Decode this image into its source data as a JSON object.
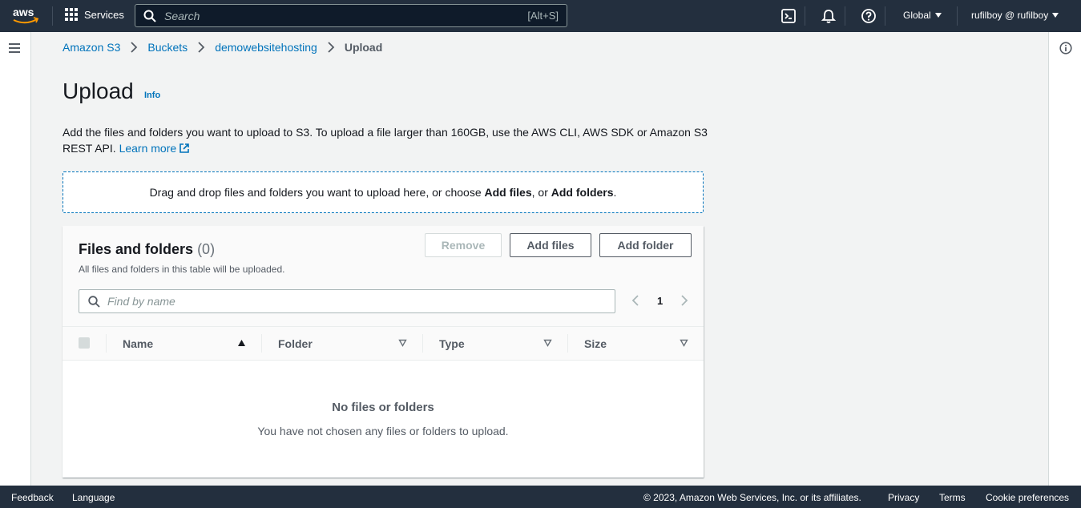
{
  "topnav": {
    "services_label": "Services",
    "search_placeholder": "Search",
    "search_shortcut": "[Alt+S]",
    "region_label": "Global",
    "account_label": "rufilboy @ rufilboy"
  },
  "breadcrumb": {
    "items": [
      "Amazon S3",
      "Buckets",
      "demowebsitehosting"
    ],
    "current": "Upload"
  },
  "page": {
    "title": "Upload",
    "info_label": "Info",
    "description": "Add the files and folders you want to upload to S3. To upload a file larger than 160GB, use the AWS CLI, AWS SDK or Amazon S3 REST API.",
    "learn_more": "Learn more"
  },
  "dropzone": {
    "text_before": "Drag and drop files and folders you want to upload here, or choose ",
    "add_files": "Add files",
    "text_middle": ", or ",
    "add_folders": "Add folders",
    "text_after": "."
  },
  "files_panel": {
    "title": "Files and folders",
    "count": "(0)",
    "subtitle": "All files and folders in this table will be uploaded.",
    "remove_label": "Remove",
    "add_files_label": "Add files",
    "add_folder_label": "Add folder",
    "filter_placeholder": "Find by name",
    "page_number": "1",
    "columns": [
      "Name",
      "Folder",
      "Type",
      "Size"
    ],
    "empty_title": "No files or folders",
    "empty_message": "You have not chosen any files or folders to upload."
  },
  "footer": {
    "feedback": "Feedback",
    "language": "Language",
    "copyright": "© 2023, Amazon Web Services, Inc. or its affiliates.",
    "privacy": "Privacy",
    "terms": "Terms",
    "cookie": "Cookie preferences"
  },
  "colors": {
    "nav_bg": "#232f3e",
    "link": "#0073bb",
    "accent_orange": "#ff9900"
  }
}
